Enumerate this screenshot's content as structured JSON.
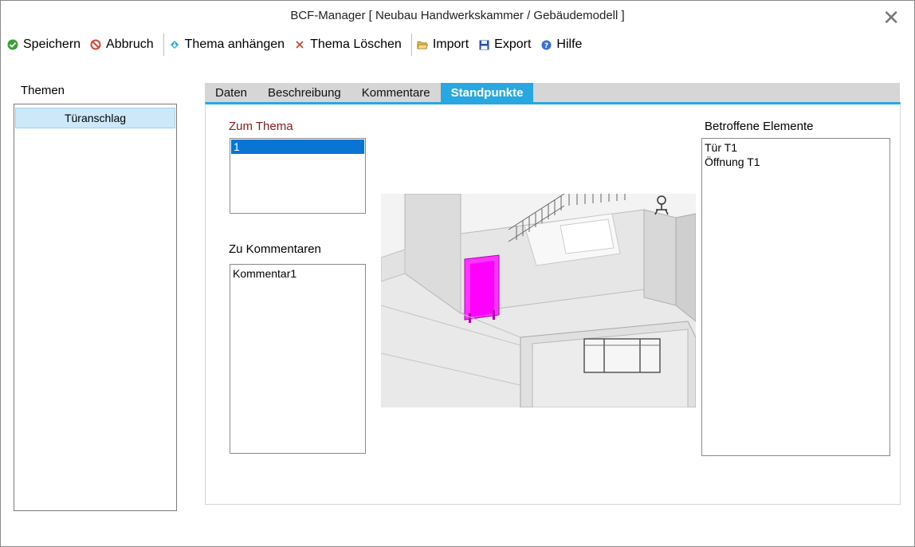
{
  "window": {
    "title": "BCF-Manager [ Neubau Handwerkskammer /  Gebäudemodell ]",
    "close_glyph": "✕"
  },
  "toolbar": {
    "save": "Speichern",
    "cancel": "Abbruch",
    "attach_topic": "Thema anhängen",
    "delete_topic": "Thema Löschen",
    "import": "Import",
    "export": "Export",
    "help": "Hilfe"
  },
  "icons": {
    "save": "check-circle-icon",
    "cancel": "prohibited-icon",
    "attach": "diamond-arrow-icon",
    "delete": "x-icon",
    "import": "folder-open-icon",
    "export": "floppy-disk-icon",
    "help": "help-circle-icon"
  },
  "colors": {
    "accent": "#28a7e0",
    "selection": "#0a74d5",
    "list_highlight": "#cde8f8",
    "label_red": "#8b1a1a",
    "highlight_magenta": "#ff00ff"
  },
  "sidebar": {
    "label": "Themen",
    "items": [
      "Türanschlag"
    ]
  },
  "tabs": [
    {
      "label": "Daten",
      "active": false
    },
    {
      "label": "Beschreibung",
      "active": false
    },
    {
      "label": "Kommentare",
      "active": false
    },
    {
      "label": "Standpunkte",
      "active": true
    }
  ],
  "panel": {
    "topic_label": "Zum Thema",
    "topic_items": [
      "1"
    ],
    "comments_label": "Zu Kommentaren",
    "comment_items": [
      "Kommentar1"
    ],
    "elements_label": "Betroffene Elemente",
    "element_items": [
      "Tür T1",
      "Öffnung T1"
    ]
  }
}
